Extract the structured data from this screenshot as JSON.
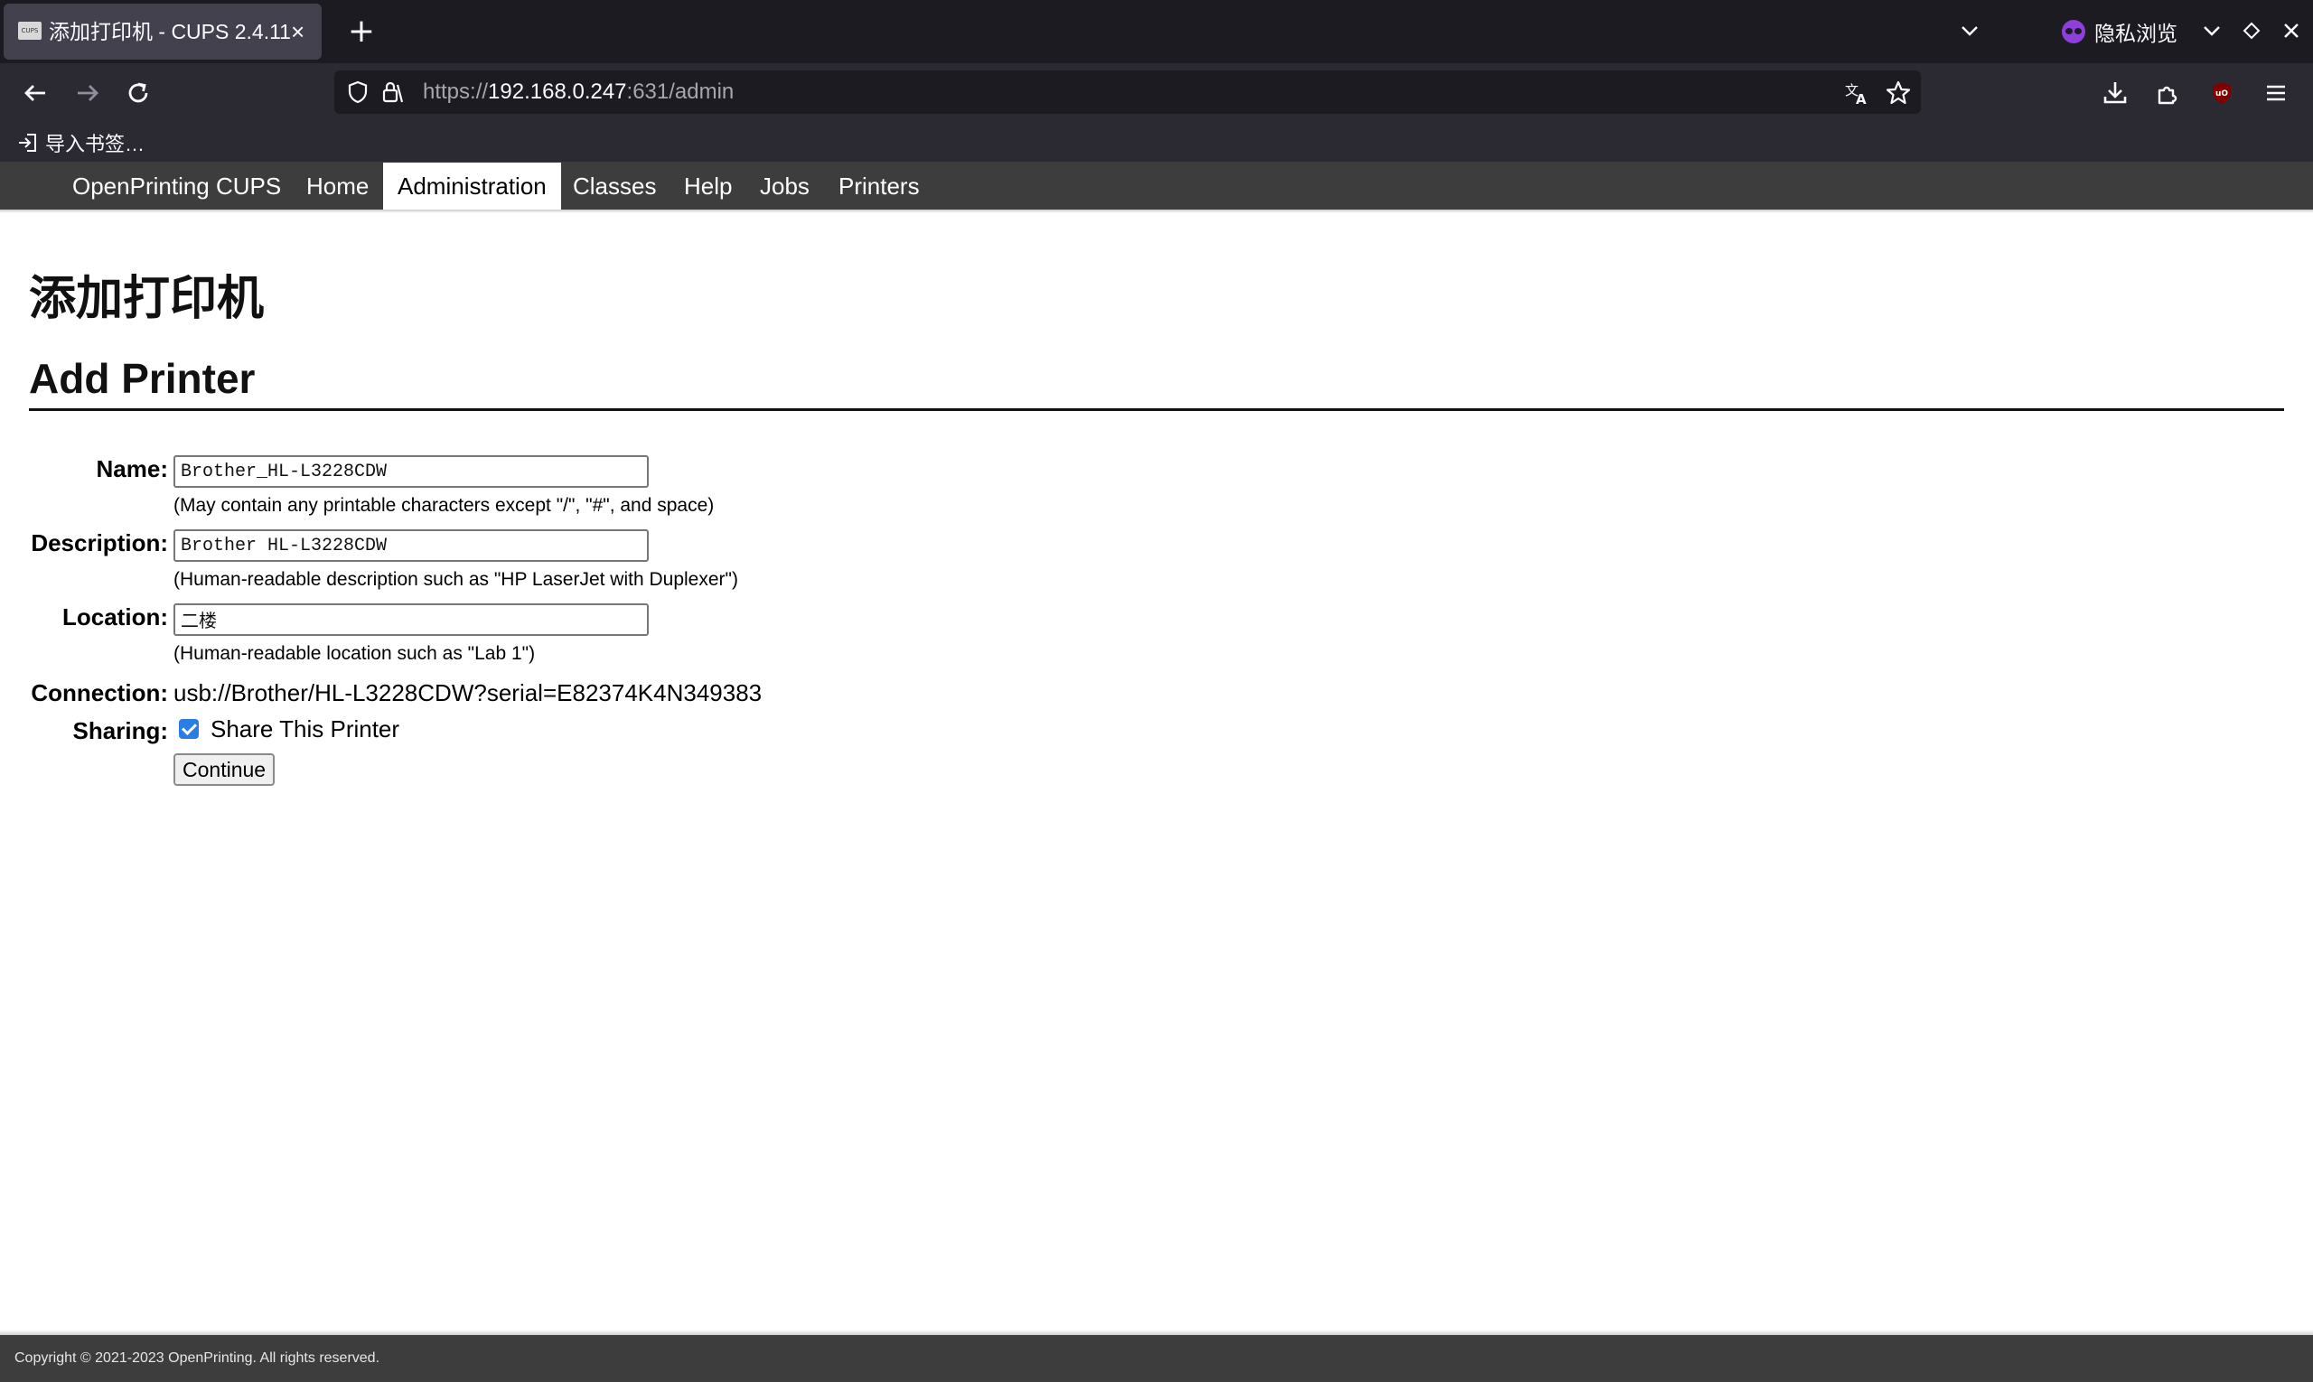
{
  "browser": {
    "tab": {
      "favicon_text": "CUPS",
      "title": "添加打印机 - CUPS 2.4.11",
      "close_glyph": "×"
    },
    "new_tab_glyph": "+",
    "private_label": "隐私浏览",
    "url": {
      "scheme": "https://",
      "host": "192.168.0.247",
      "rest": ":631/admin"
    },
    "bookmark_import": "导入书签…"
  },
  "cups_nav": {
    "brand": "OpenPrinting CUPS",
    "items": [
      "Home",
      "Administration",
      "Classes",
      "Help",
      "Jobs",
      "Printers"
    ],
    "active": "Administration"
  },
  "page": {
    "title_zh": "添加打印机",
    "heading": "Add Printer"
  },
  "form": {
    "name_label": "Name:",
    "name_value": "Brother_HL-L3228CDW",
    "name_hint": "(May contain any printable characters except \"/\", \"#\", and space)",
    "description_label": "Description:",
    "description_value": "Brother HL-L3228CDW",
    "description_hint": "(Human-readable description such as \"HP LaserJet with Duplexer\")",
    "location_label": "Location:",
    "location_value": "二楼",
    "location_hint": "(Human-readable location such as \"Lab 1\")",
    "connection_label": "Connection:",
    "connection_value": "usb://Brother/HL-L3228CDW?serial=E82374K4N349383",
    "sharing_label": "Sharing:",
    "sharing_checked": true,
    "sharing_option": "Share This Printer",
    "continue_label": "Continue"
  },
  "footer": {
    "copyright": "Copyright © 2021-2023 OpenPrinting. All rights reserved."
  },
  "colors": {
    "tabbar_bg": "#1c1b22",
    "toolbar_bg": "#2b2a33",
    "cups_nav_bg": "#3d3d3d",
    "checkbox_blue": "#2a7de1",
    "ublock_red": "#800000"
  },
  "icons": {
    "back": "arrow-left-icon",
    "forward": "arrow-right-icon",
    "reload": "reload-icon",
    "shield": "tracking-shield-icon",
    "lock": "lock-icon",
    "translate": "translate-icon",
    "bookmark": "star-icon",
    "downloads": "download-icon",
    "extensions": "puzzle-icon",
    "ublock": "ublock-origin-icon",
    "menu": "hamburger-menu-icon"
  }
}
